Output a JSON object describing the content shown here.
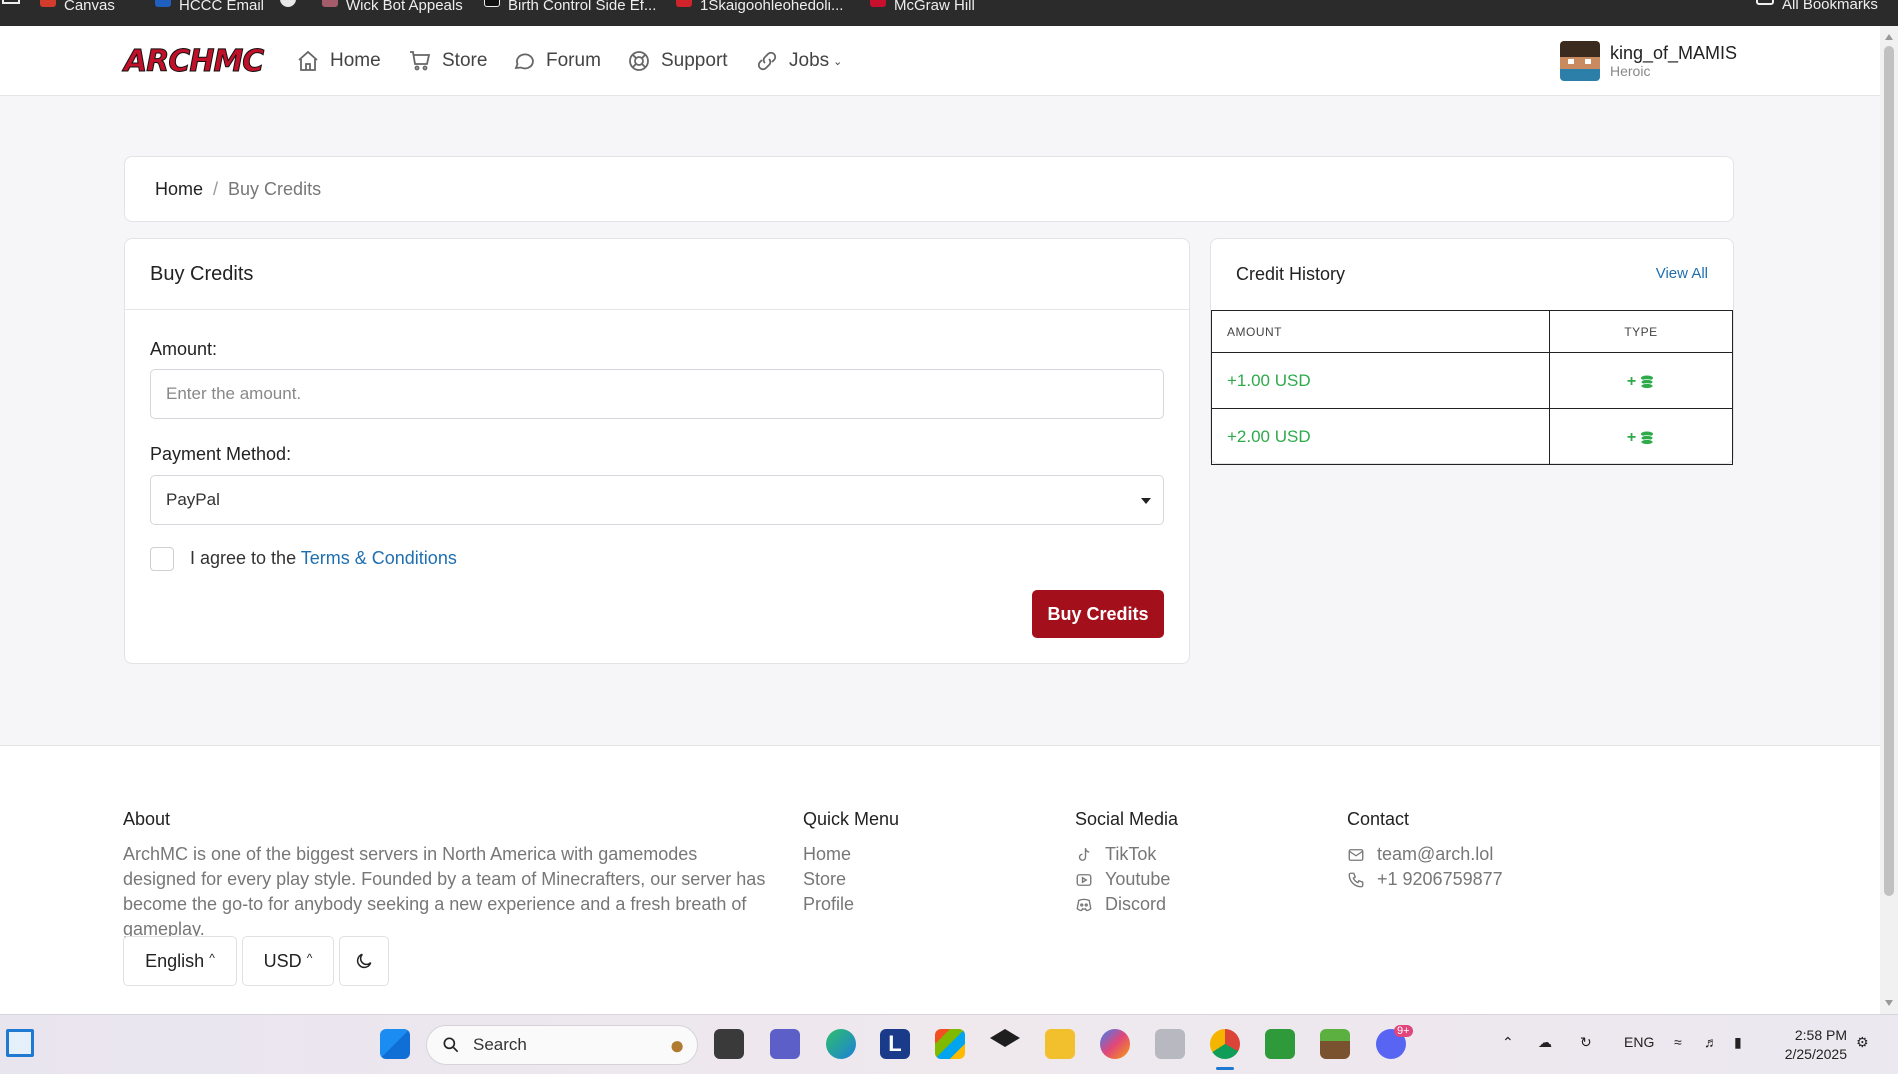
{
  "browser": {
    "bookmarks": [
      {
        "label": "Canvas",
        "color": "#d33b2c"
      },
      {
        "label": "HCCC Email",
        "color": "#1f5fbf"
      },
      {
        "label": "",
        "color": "#e8e8e8"
      },
      {
        "label": "Wick Bot Appeals",
        "color": "#a45c6b"
      },
      {
        "label": "Birth Control Side Ef...",
        "color": "#111111"
      },
      {
        "label": "1Skaigoohleohedoli...",
        "color": "#d0242a"
      },
      {
        "label": "McGraw Hill",
        "color": "#c8102e"
      }
    ],
    "all_bookmarks": "All Bookmarks"
  },
  "header": {
    "logo": "ARCHMC",
    "nav": [
      {
        "label": "Home",
        "icon": "home-icon"
      },
      {
        "label": "Store",
        "icon": "cart-icon"
      },
      {
        "label": "Forum",
        "icon": "chat-icon"
      },
      {
        "label": "Support",
        "icon": "lifebuoy-icon"
      },
      {
        "label": "Jobs",
        "icon": "link-icon"
      }
    ],
    "user": {
      "name": "king_of_MAMIS",
      "rank": "Heroic"
    }
  },
  "breadcrumb": {
    "home": "Home",
    "separator": "/",
    "current": "Buy Credits"
  },
  "buy_credits": {
    "title": "Buy Credits",
    "amount_label": "Amount:",
    "amount_placeholder": "Enter the amount.",
    "amount_value": "",
    "payment_label": "Payment Method:",
    "payment_selected": "PayPal",
    "agree_prefix": "I agree to the",
    "terms_link": "Terms & Conditions",
    "terms_checked": false,
    "button": "Buy Credits",
    "button_color": "#a3101c"
  },
  "credit_history": {
    "title": "Credit History",
    "view_all": "View All",
    "columns": [
      "AMOUNT",
      "TYPE"
    ],
    "rows": [
      {
        "amount": "+1.00 USD",
        "type": "+"
      },
      {
        "amount": "+2.00 USD",
        "type": "+"
      }
    ],
    "positive_color": "#2eaa4a"
  },
  "footer": {
    "about": {
      "title": "About",
      "text": "ArchMC is one of the biggest servers in North America with gamemodes designed for every play style. Founded by a team of Minecrafters, our server has become the go-to for anybody seeking a new experience and a fresh breath of gameplay."
    },
    "quick_menu": {
      "title": "Quick Menu",
      "links": [
        "Home",
        "Store",
        "Profile"
      ]
    },
    "social": {
      "title": "Social Media",
      "links": [
        {
          "label": "TikTok",
          "icon": "tiktok-icon"
        },
        {
          "label": "Youtube",
          "icon": "youtube-icon"
        },
        {
          "label": "Discord",
          "icon": "discord-icon"
        }
      ]
    },
    "contact": {
      "title": "Contact",
      "email": "team@arch.lol",
      "phone": "+1 9206759877"
    },
    "language": "English",
    "currency": "USD",
    "theme_icon": "moon-icon"
  },
  "taskbar": {
    "search": "Search",
    "tray_lang": "ENG",
    "time": "2:58 PM",
    "date": "2/25/2025",
    "discord_badge": "9+"
  }
}
